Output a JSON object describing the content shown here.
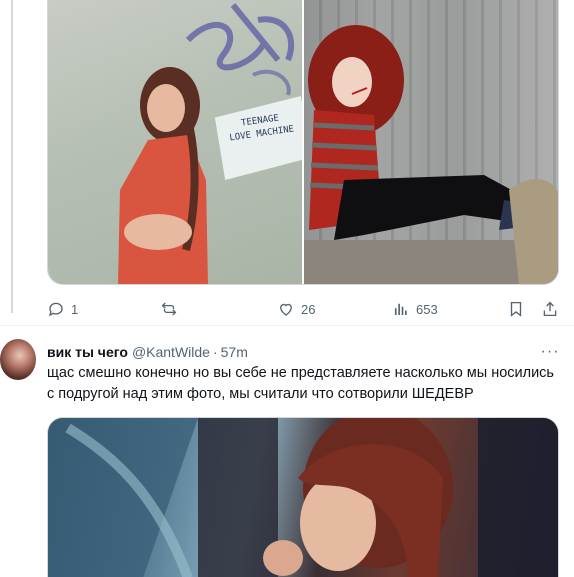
{
  "tweet_stats": {
    "replies": "1",
    "retweets": "",
    "likes": "26",
    "views": "653"
  },
  "reply": {
    "display_name": "вик ты чего",
    "handle": "@KantWilde",
    "separator": "·",
    "time": "57m",
    "more": "···",
    "text": "щас смешно конечно но вы себе не представляете насколько мы носились с подругой над этим фото, мы считали что сотворили ШЕДЕВР"
  },
  "photo_sign": {
    "line1": "TEENAGE",
    "line2": "LOVE MACHINE"
  },
  "icons": [
    "reply-icon",
    "retweet-icon",
    "like-icon",
    "views-icon",
    "bookmark-icon",
    "share-icon",
    "more-icon"
  ]
}
